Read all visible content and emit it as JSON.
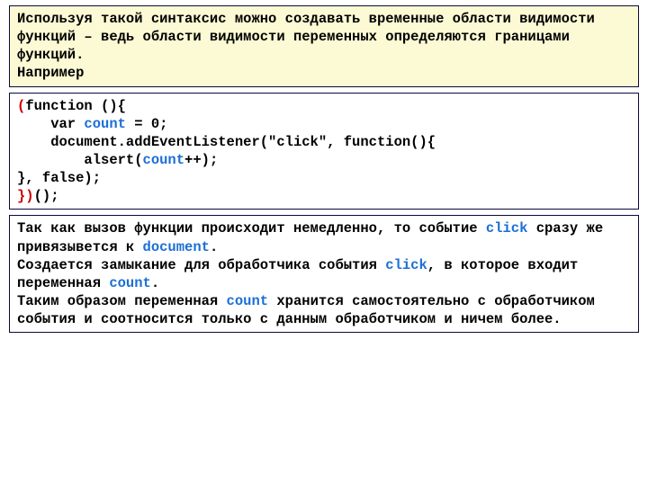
{
  "intro": {
    "line1": "Используя такой синтаксис можно создавать временные области видимости функций – ведь области видимости переменных определяются границами функций.",
    "line2": "Например"
  },
  "code": {
    "c0a": "(",
    "c0b": "function (){",
    "c1a": "    var ",
    "c1b": "count",
    "c1c": " = 0;",
    "c2": "    document.addEventListener(\"click\", function(){",
    "c3a": "        alsert(",
    "c3b": "count",
    "c3c": "++);",
    "c4": "}, false);",
    "c5a": "})",
    "c5b": "();"
  },
  "outro": {
    "p1a": "Так как вызов функции происходит немедленно, то событие ",
    "p1b": "click",
    "p1c": " сразу же привязывется к ",
    "p1d": "document",
    "p1e": ".",
    "p2a": "Создается замыкание для обработчика события ",
    "p2b": "click",
    "p2c": ", в которое входит переменная ",
    "p2d": "count",
    "p2e": ".",
    "p3a": "Таким образом переменная ",
    "p3b": "count",
    "p3c": " хранится самостоятельно с обработчиком события и соотносится только с данным обработчиком и ничем более."
  }
}
